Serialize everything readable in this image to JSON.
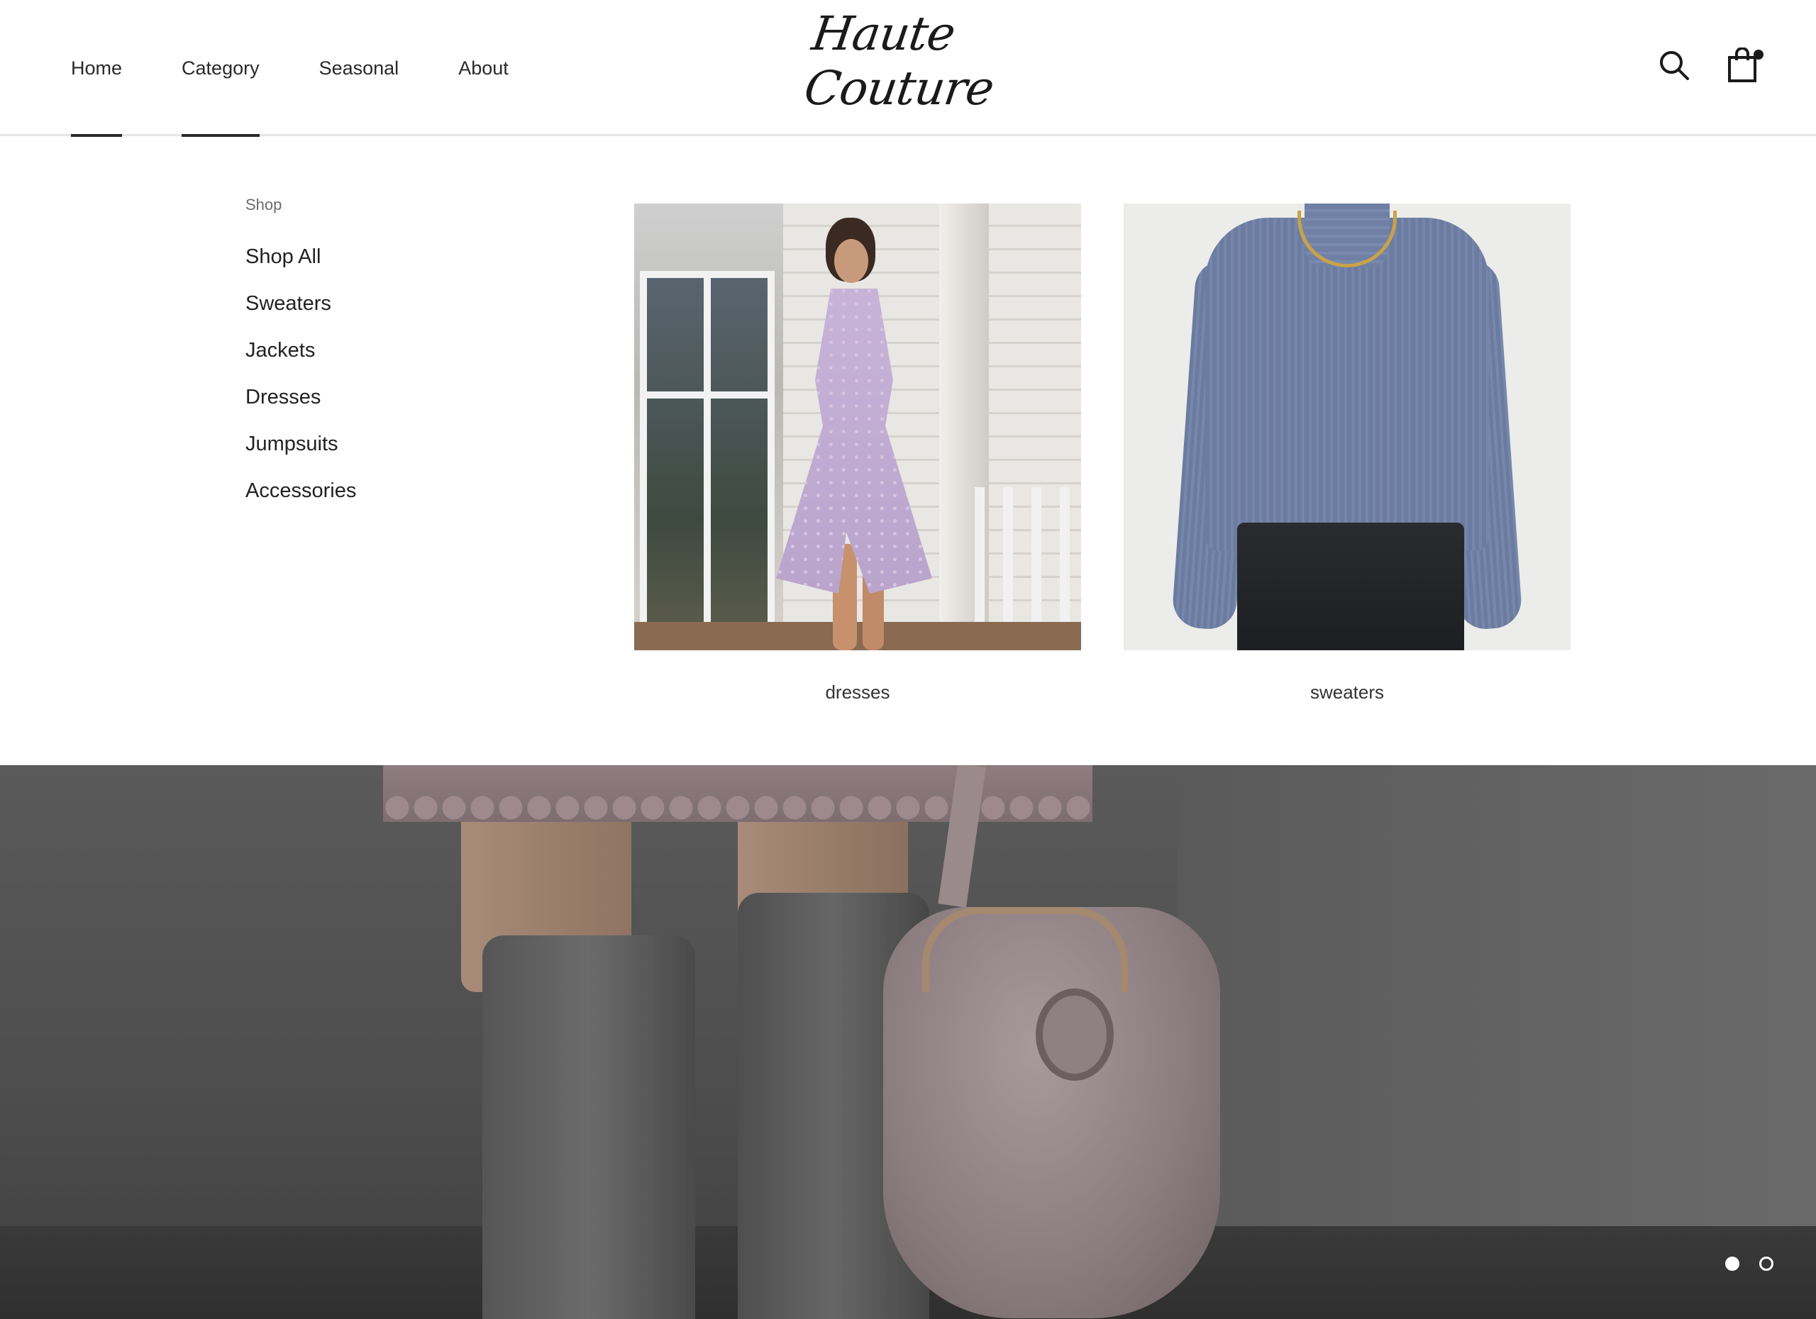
{
  "header": {
    "nav": [
      {
        "label": "Home"
      },
      {
        "label": "Category"
      },
      {
        "label": "Seasonal"
      },
      {
        "label": "About"
      }
    ],
    "logo_text": "Haute Couture",
    "icons": [
      "search-icon",
      "shopping-bag-icon"
    ]
  },
  "mega_menu": {
    "heading": "Shop",
    "items": [
      {
        "label": "Shop All"
      },
      {
        "label": "Sweaters"
      },
      {
        "label": "Jackets"
      },
      {
        "label": "Dresses"
      },
      {
        "label": "Jumpsuits"
      },
      {
        "label": "Accessories"
      }
    ],
    "cards": [
      {
        "caption": "dresses"
      },
      {
        "caption": "sweaters"
      }
    ]
  },
  "hero": {
    "slide_count": 2,
    "active_slide": 1
  },
  "colors": {
    "text": "#222222",
    "muted": "#6b6b6b",
    "background": "#ffffff"
  }
}
